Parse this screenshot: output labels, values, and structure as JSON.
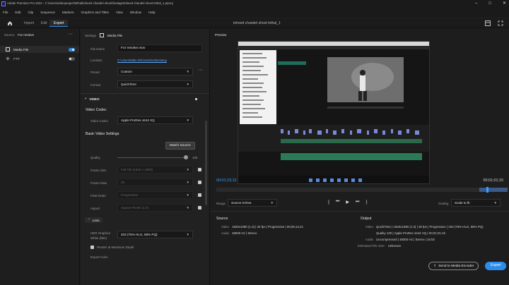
{
  "window": {
    "title": "Adobe Premiere Pro 2022 - C:\\Users\\videoproject\\lethal\\toheed chandel shoot\\footage\\toheed chandel shoot lethal_1.prproj",
    "controls": [
      "–",
      "□",
      "✕"
    ]
  },
  "menu": [
    "File",
    "Edit",
    "Clip",
    "Sequence",
    "Markers",
    "Graphics and Titles",
    "View",
    "Window",
    "Help"
  ],
  "tabs": {
    "home_icon": "home-icon",
    "import": "Import",
    "edit": "Edit",
    "export": "Export",
    "center_title": "toheed chandel shoot lethal_1"
  },
  "left": {
    "source_label": "Source:",
    "source_value": "For resolve",
    "items": [
      {
        "label": "Media File",
        "enabled": true
      },
      {
        "label": "FTP",
        "enabled": false
      }
    ]
  },
  "settings": {
    "header": "Settings",
    "target": "Media File",
    "file_name_label": "File Name",
    "file_name": "For resolve.mov",
    "location_label": "Location",
    "location": "C:\\Users\\Mike W\\OneDrive\\Desktop",
    "preset_label": "Preset",
    "preset": "Custom",
    "format_label": "Format",
    "format": "QuickTime",
    "video_section": "VIDEO",
    "video_codec_heading": "Video Codec",
    "video_codec_label": "Video Codec",
    "video_codec": "Apple ProRes 4444 XQ",
    "basic_heading": "Basic Video Settings",
    "match_source": "Match Source",
    "quality_label": "Quality",
    "quality_value": "100",
    "frame_size_label": "Frame Size",
    "frame_size": "Full HD (1920 x 1080)",
    "frame_rate_label": "Frame Rate",
    "frame_rate": "25",
    "field_order_label": "Field Order",
    "field_order": "Progressive",
    "aspect_label": "Aspect",
    "aspect": "Square Pixels (1.0)",
    "less_button": "Less",
    "hdr_label": "HDR Graphics White (Nits)",
    "hdr_value": "203 (75% HLG, 58% PQ)",
    "render_max_depth": "Render at Maximum Depth",
    "export_color_label": "Export Color"
  },
  "preview": {
    "header": "Preview",
    "timecode_in": "00;01;23;12",
    "timecode_out": "00;01;01;15",
    "range_label": "Range",
    "range_value": "Source In/Out",
    "scaling_label": "Scaling",
    "scaling_value": "Scale to fit",
    "source": {
      "heading": "Source",
      "video_key": "Video",
      "video": "1920x1080 (1.0)  |  25 fps  |  Progressive  |  00;00;12;21",
      "audio_key": "Audio",
      "audio": "48000 Hz  |  Stereo"
    },
    "output": {
      "heading": "Output",
      "video_key": "Video",
      "video_1": "QuickTime  |  1920x1080 (1.0)  |  25 fps  |  Progressive  |  203 (75% HLG, 58% PQ)",
      "video_2": "Quality 100  |  Apple ProRes 4444 XQ  |  00;01;01;15",
      "audio_key": "Audio",
      "audio": "Uncompressed  |  48000 Hz  |  Stereo  |  16 bit",
      "size_key": "Estimated File Size:",
      "size": "Unknown"
    },
    "send_button": "Send to Media Encoder",
    "export_button": "Export"
  },
  "colors": {
    "accent": "#2d8ceb",
    "timecode": "#3aa0ff"
  }
}
